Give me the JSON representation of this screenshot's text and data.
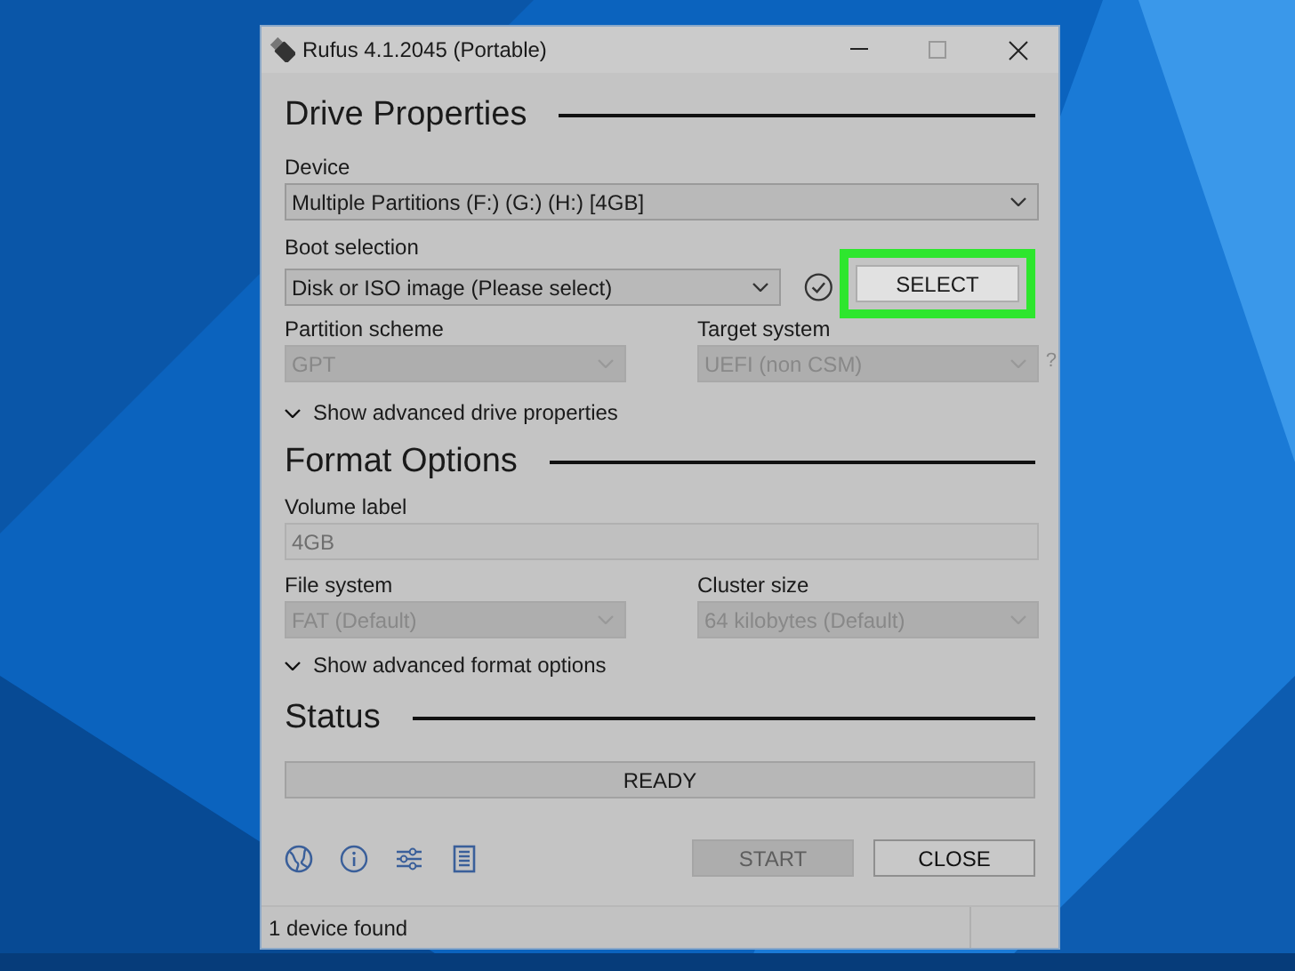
{
  "window": {
    "title": "Rufus 4.1.2045 (Portable)"
  },
  "drive_properties": {
    "heading": "Drive Properties",
    "device": {
      "label": "Device",
      "value": "Multiple Partitions (F:) (G:) (H:) [4GB]",
      "disabled": false
    },
    "boot_selection": {
      "label": "Boot selection",
      "value": "Disk or ISO image (Please select)",
      "disabled": false,
      "button": "SELECT",
      "highlighted": true
    },
    "partition_scheme": {
      "label": "Partition scheme",
      "value": "GPT",
      "disabled": true
    },
    "target_system": {
      "label": "Target system",
      "value": "UEFI (non CSM)",
      "disabled": true,
      "help": "?"
    },
    "advanced_toggle": {
      "label": "Show advanced drive properties",
      "expanded": false
    }
  },
  "format_options": {
    "heading": "Format Options",
    "volume_label": {
      "label": "Volume label",
      "value": "4GB",
      "disabled": true
    },
    "file_system": {
      "label": "File system",
      "value": "FAT (Default)",
      "disabled": true
    },
    "cluster_size": {
      "label": "Cluster size",
      "value": "64 kilobytes (Default)",
      "disabled": true
    },
    "advanced_toggle": {
      "label": "Show advanced format options",
      "expanded": false
    }
  },
  "status": {
    "heading": "Status",
    "progress": {
      "text": "READY",
      "level": 0
    }
  },
  "buttons": [
    {
      "label": "START",
      "disabled": true
    },
    {
      "label": "CLOSE",
      "disabled": false
    }
  ],
  "status_bar": {
    "text": "1 device found"
  }
}
